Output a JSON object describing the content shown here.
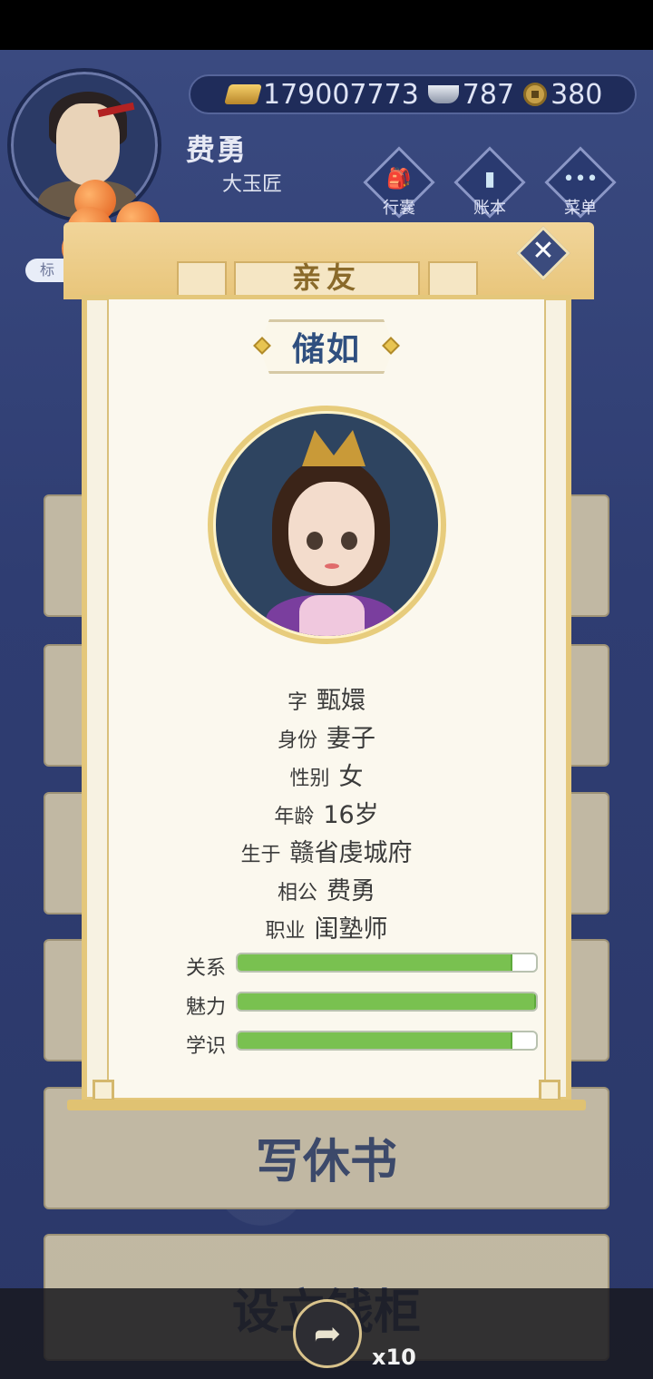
{
  "hud": {
    "gold": "179007773",
    "silver": "787",
    "coins": "380",
    "player_name": "费勇",
    "player_title": "大玉匠",
    "buttons": [
      {
        "label": "行囊",
        "icon": "bag-icon"
      },
      {
        "label": "账本",
        "icon": "ledger-icon"
      },
      {
        "label": "菜单",
        "icon": "menu-icon"
      }
    ],
    "side_label": "标"
  },
  "background_cards": {
    "divorce": "写休书",
    "vault": "设立钱柜"
  },
  "dialog": {
    "title": "亲友",
    "close_icon": "close-icon",
    "name": "储如",
    "info": [
      {
        "key": "字",
        "value": "甄嬛"
      },
      {
        "key": "身份",
        "value": "妻子"
      },
      {
        "key": "性别",
        "value": "女"
      },
      {
        "key": "年龄",
        "value": "16岁"
      },
      {
        "key": "生于",
        "value": "赣省虔城府"
      },
      {
        "key": "相公",
        "value": "费勇"
      },
      {
        "key": "职业",
        "value": "闺塾师"
      }
    ],
    "stats": [
      {
        "label": "关系",
        "level": 0.92
      },
      {
        "label": "魅力",
        "level": 1.0
      },
      {
        "label": "学识",
        "level": 0.92
      }
    ]
  },
  "bottom": {
    "share_icon": "share-icon",
    "count": "x10"
  }
}
